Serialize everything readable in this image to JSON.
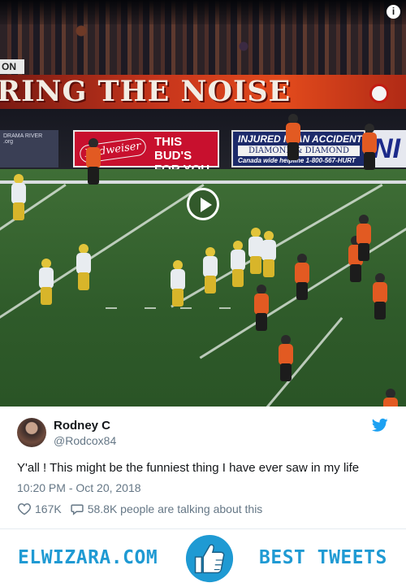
{
  "video": {
    "banner_small": "ON",
    "banner_text": "RING THE NOISE",
    "ad_left_text": "DRAMA RIVER\n.org",
    "ad_bud_script": "Budweiser",
    "ad_bud_text": "THIS BUD'S\nFOR YOU.",
    "ad_injured_line1": "INJURED IN AN ACCIDENT",
    "ad_injured_line2": "DIAMOND & DIAMOND",
    "ad_injured_line3": "Canada wide helpline 1-800-567-HURT",
    "ad_right": "NI",
    "play_icon": "play-icon",
    "info_icon": "info-icon",
    "info_glyph": "i"
  },
  "tweet": {
    "author_name": "Rodney C",
    "author_handle": "@Rodcox84",
    "text": "Y'all ! This might be the funniest thing I have ever saw in my life",
    "timestamp": "10:20 PM - Oct 20, 2018",
    "likes": "167K",
    "talking": "58.8K people are talking about this",
    "brand_icon": "twitter-bird-icon",
    "accent": "#1da1f2"
  },
  "footer": {
    "left_brand": "ELWIZARA.COM",
    "right_brand": "BEST TWEETS",
    "thumb_icon": "thumbs-up-icon",
    "brand_color": "#1f9ad3"
  }
}
